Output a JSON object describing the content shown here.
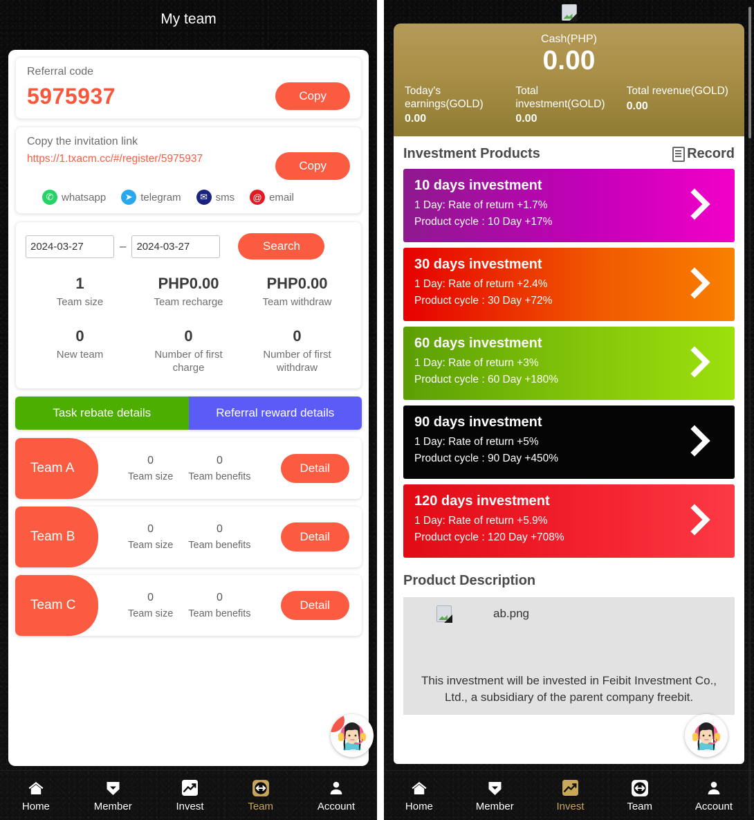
{
  "left": {
    "title": "My team",
    "referral": {
      "label": "Referral code",
      "code": "5975937",
      "copy_label": "Copy"
    },
    "invite": {
      "label": "Copy the invitation link",
      "url": "https://1.txacm.cc/#/register/5975937",
      "copy_label": "Copy",
      "socials": [
        {
          "name": "whatsapp",
          "glyph": "✆"
        },
        {
          "name": "telegram",
          "glyph": "➤"
        },
        {
          "name": "sms",
          "glyph": "✉"
        },
        {
          "name": "email",
          "glyph": "@"
        }
      ]
    },
    "search": {
      "date_from": "2024-03-27",
      "date_to": "2024-03-27",
      "separator": "–",
      "button_label": "Search"
    },
    "stats": [
      {
        "value": "1",
        "label": "Team size"
      },
      {
        "value": "PHP0.00",
        "label": "Team recharge"
      },
      {
        "value": "PHP0.00",
        "label": "Team withdraw"
      },
      {
        "value": "0",
        "label": "New team"
      },
      {
        "value": "0",
        "label": "Number of first charge"
      },
      {
        "value": "0",
        "label": "Number of first withdraw"
      }
    ],
    "tabs": [
      {
        "label": "Task rebate details",
        "color": "#4caf00"
      },
      {
        "label": "Referral reward details",
        "color": "#5b5bf5"
      }
    ],
    "teams": [
      {
        "name": "Team A",
        "size": "0",
        "size_label": "Team size",
        "benefits": "0",
        "benefits_label": "Team benefits",
        "detail_label": "Detail"
      },
      {
        "name": "Team B",
        "size": "0",
        "size_label": "Team size",
        "benefits": "0",
        "benefits_label": "Team benefits",
        "detail_label": "Detail"
      },
      {
        "name": "Team C",
        "size": "0",
        "size_label": "Team size",
        "benefits": "0",
        "benefits_label": "Team benefits",
        "detail_label": "Detail"
      }
    ],
    "nav": {
      "active": "Team",
      "items": [
        {
          "label": "Home",
          "icon": "home-icon"
        },
        {
          "label": "Member",
          "icon": "heart-badge-icon"
        },
        {
          "label": "Invest",
          "icon": "chart-up-icon"
        },
        {
          "label": "Team",
          "icon": "arrows-horizontal-icon"
        },
        {
          "label": "Account",
          "icon": "person-icon"
        }
      ]
    }
  },
  "right": {
    "header_image_alt": "broken-image",
    "balance": {
      "cash_label": "Cash(PHP)",
      "cash_value": "0.00",
      "metrics": [
        {
          "label": "Today's earnings(GOLD)",
          "value": "0.00"
        },
        {
          "label": "Total investment(GOLD)",
          "value": "0.00"
        },
        {
          "label": "Total revenue(GOLD)",
          "value": "0.00"
        }
      ]
    },
    "section": {
      "title": "Investment Products",
      "record_label": "Record"
    },
    "products": [
      {
        "name": "10 days investment",
        "rate_line": "1 Day: Rate of return +1.7%",
        "cycle_line": "Product cycle : 10 Day +17%",
        "theme": "p-10"
      },
      {
        "name": "30 days investment",
        "rate_line": "1 Day: Rate of return +2.4%",
        "cycle_line": "Product cycle : 30 Day +72%",
        "theme": "p-30"
      },
      {
        "name": "60 days investment",
        "rate_line": "1 Day: Rate of return +3%",
        "cycle_line": "Product cycle : 60 Day +180%",
        "theme": "p-60"
      },
      {
        "name": "90 days investment",
        "rate_line": "1 Day: Rate of return +5%",
        "cycle_line": "Product cycle : 90 Day +450%",
        "theme": "p-90"
      },
      {
        "name": "120 days investment",
        "rate_line": "1 Day: Rate of return +5.9%",
        "cycle_line": "Product cycle : 120 Day +708%",
        "theme": "p-120"
      }
    ],
    "description": {
      "title": "Product Description",
      "image_alt": "ab.png",
      "text": "This investment will be invested in Feibit Investment Co., Ltd., a subsidiary of the parent company freebit."
    },
    "nav": {
      "active": "Invest",
      "items": [
        {
          "label": "Home",
          "icon": "home-icon"
        },
        {
          "label": "Member",
          "icon": "heart-badge-icon"
        },
        {
          "label": "Invest",
          "icon": "chart-up-icon"
        },
        {
          "label": "Team",
          "icon": "arrows-horizontal-icon"
        },
        {
          "label": "Account",
          "icon": "person-icon"
        }
      ]
    }
  },
  "colors": {
    "accent_red": "#fa5b41",
    "gold": "#b49a58",
    "tab_green": "#4caf00",
    "tab_blue": "#5b5bf5",
    "background_dark": "#0b0b0b"
  }
}
